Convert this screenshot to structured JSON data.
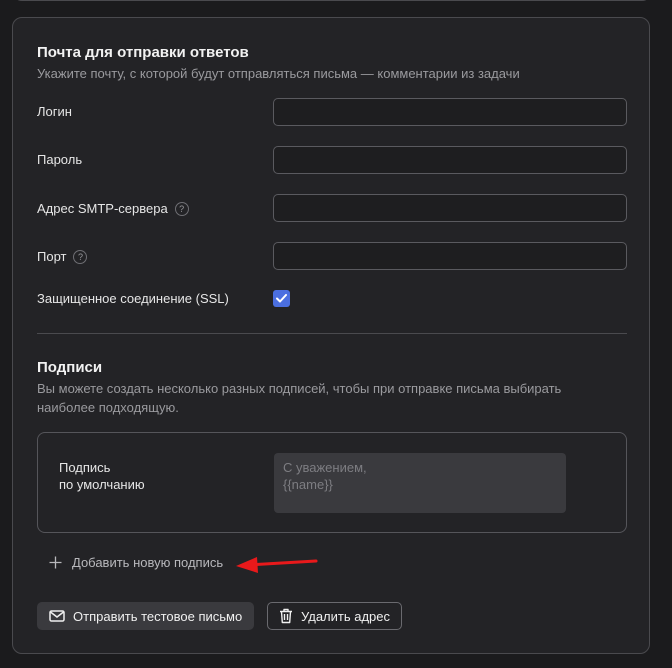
{
  "mail_section": {
    "title": "Почта для отправки ответов",
    "description": "Укажите почту, с которой будут отправляться письма — комментарии из задачи",
    "fields": {
      "login": {
        "label": "Логин",
        "value": ""
      },
      "password": {
        "label": "Пароль",
        "value": ""
      },
      "smtp": {
        "label": "Адрес SMTP-сервера",
        "value": "",
        "help": "?"
      },
      "port": {
        "label": "Порт",
        "value": "",
        "help": "?"
      }
    },
    "ssl": {
      "label": "Защищенное соединение (SSL)",
      "checked": true
    }
  },
  "signatures": {
    "title": "Подписи",
    "description": "Вы можете создать несколько разных подписей, чтобы при отправке письма выбирать наиболее подходящую.",
    "default_label_line1": "Подпись",
    "default_label_line2": "по умолчанию",
    "text_placeholder": "С уважением,\n{{name}}",
    "add_label": "Добавить новую подпись"
  },
  "actions": {
    "send_test_label": "Отправить тестовое письмо",
    "delete_label": "Удалить адрес"
  },
  "colors": {
    "accent": "#4b6fe0",
    "annotation_arrow": "#e8191b"
  },
  "icons": {
    "add": "plus-icon",
    "mail": "envelope-icon",
    "delete": "trash-icon",
    "check": "check-icon"
  }
}
